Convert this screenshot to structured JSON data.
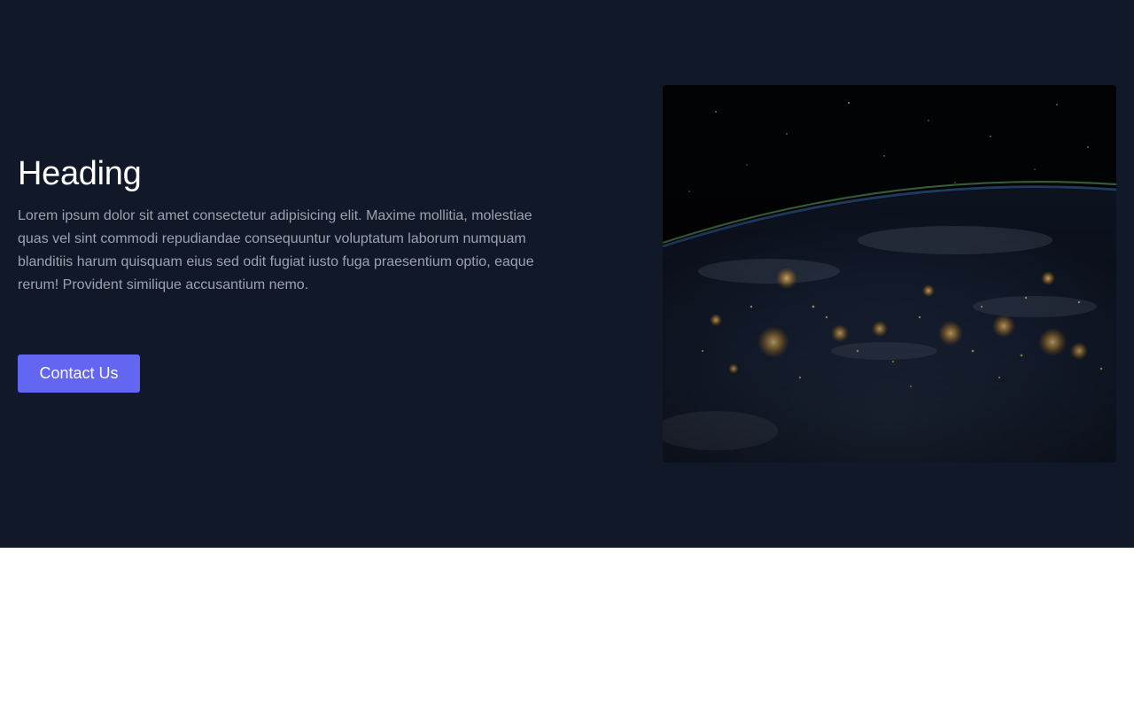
{
  "hero": {
    "heading": "Heading",
    "body": "Lorem ipsum dolor sit amet consectetur adipisicing elit. Maxime mollitia, molestiae quas vel sint commodi repudiandae consequuntur voluptatum laborum numquam blanditiis harum quisquam eius sed odit fugiat iusto fuga praesentium optio, eaque rerum! Provident similique accusantium nemo.",
    "button_label": "Contact Us",
    "image": "earth-at-night-from-space"
  },
  "colors": {
    "background": "#111827",
    "heading": "#ffffff",
    "body_text": "#9ca3af",
    "accent": "#6366f1"
  }
}
